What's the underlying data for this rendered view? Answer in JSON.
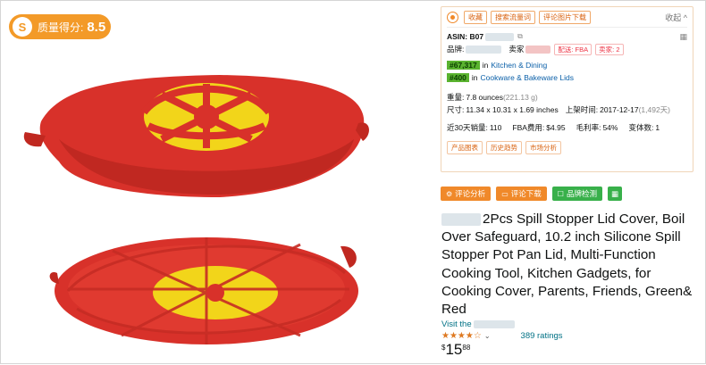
{
  "score": {
    "label": "质量得分:",
    "value": "8.5"
  },
  "panel": {
    "top_buttons": [
      "收藏",
      "搜索流量词",
      "评论图片下载"
    ],
    "collapse": "收起 ^",
    "asin_label": "ASIN: B07",
    "brand_label": "品牌:",
    "seller_label": "卖家",
    "fba_tag": "配送: FBA",
    "seller_count_tag": "卖家: 2",
    "rank1": "#67,317",
    "rank1_in": "in",
    "rank1_cat": "Kitchen & Dining",
    "rank2": "#400",
    "rank2_in": "in",
    "rank2_cat": "Cookware & Bakeware Lids",
    "weight_label": "重量:",
    "weight_value": "7.8 ounces",
    "weight_g": "(221.13 g)",
    "size_label": "尺寸:",
    "size_value": "11.34 x 10.31 x 1.69 inches",
    "date_label": "上架时间:",
    "date_value": "2017-12-17",
    "date_days": "(1,492天)",
    "sales_label": "近30天销量:",
    "sales_value": "110",
    "fba_fee_label": "FBA费用:",
    "fba_fee_value": "$4.95",
    "margin_label": "毛利率:",
    "margin_value": "54%",
    "variants_label": "变体数:",
    "variants_value": "1",
    "bottom_tags": [
      "产品图表",
      "历史趋势",
      "市场分析"
    ]
  },
  "actions": {
    "review_analysis": "评论分析",
    "review_download": "评论下载",
    "brand_check": "品牌检测"
  },
  "product": {
    "title": "2Pcs Spill Stopper Lid Cover, Boil Over Safeguard, 10.2 inch Silicone Spill Stopper Pot Pan Lid, Multi-Function Cooking Tool, Kitchen Gadgets, for Cooking Cover, Parents, Friends, Green& Red",
    "visit_prefix": "Visit the",
    "ratings": "389 ratings",
    "price_currency": "$",
    "price_whole": "15",
    "price_fraction": "88",
    "rating_value": 4.5
  },
  "colors": {
    "accent": "#f0892a",
    "green": "#38b04a",
    "lid_red": "#d8312a",
    "lid_yellow": "#f2d51a"
  }
}
